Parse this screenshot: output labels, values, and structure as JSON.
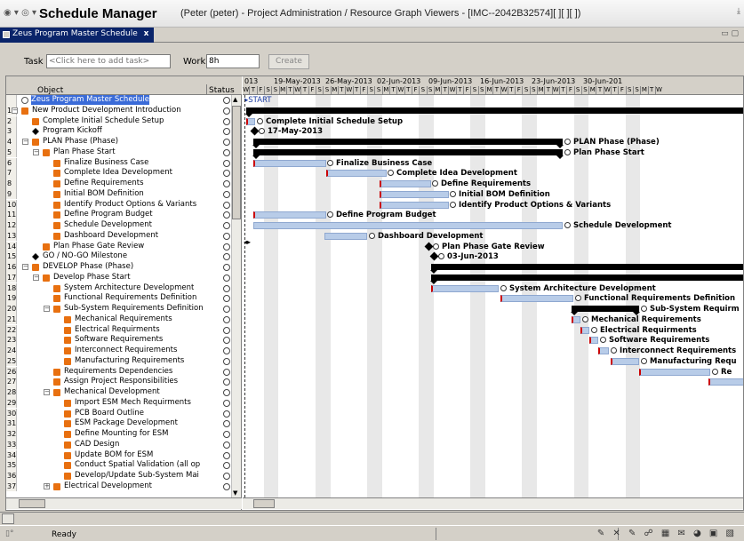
{
  "window": {
    "nav_icons": "◉ ▾ ◎ ▾",
    "app_title": "Schedule Manager",
    "context": "(Peter (peter) - Project Administration / Resource Graph Viewers - [IMC--2042B32574][ ][ ][ ])",
    "right_glyph": "⤓"
  },
  "tab": {
    "label": "Zeus Program Master Schedule",
    "close": "x",
    "right": "▭ ▢"
  },
  "task_bar": {
    "task_label": "Task",
    "task_placeholder": "<Click here to add task>",
    "work_label": "Work",
    "work_value": "8h",
    "create_label": "Create"
  },
  "outline": {
    "col_object": "Object",
    "col_status": "Status",
    "root_label": "Zeus Program Master Schedule",
    "rows": [
      {
        "n": "1",
        "label": "New Product Development Introduction",
        "lvl": 0,
        "kind": "sum",
        "twisty": "−"
      },
      {
        "n": "2",
        "label": "Complete Initial Schedule Setup",
        "lvl": 1,
        "kind": "task",
        "twisty": ""
      },
      {
        "n": "3",
        "label": "Program Kickoff",
        "lvl": 1,
        "kind": "mile",
        "twisty": ""
      },
      {
        "n": "4",
        "label": "PLAN Phase (Phase)",
        "lvl": 1,
        "kind": "sum",
        "twisty": "−"
      },
      {
        "n": "5",
        "label": "Plan Phase Start",
        "lvl": 2,
        "kind": "sum",
        "twisty": "−"
      },
      {
        "n": "6",
        "label": "Finalize Business Case",
        "lvl": 3,
        "kind": "task",
        "twisty": ""
      },
      {
        "n": "7",
        "label": "Complete Idea Development",
        "lvl": 3,
        "kind": "task",
        "twisty": ""
      },
      {
        "n": "8",
        "label": "Define Requirements",
        "lvl": 3,
        "kind": "task",
        "twisty": ""
      },
      {
        "n": "9",
        "label": "Initial BOM Definition",
        "lvl": 3,
        "kind": "task",
        "twisty": ""
      },
      {
        "n": "10",
        "label": "Identify Product Options & Variants",
        "lvl": 3,
        "kind": "task",
        "twisty": ""
      },
      {
        "n": "11",
        "label": "Define Program Budget",
        "lvl": 3,
        "kind": "task",
        "twisty": ""
      },
      {
        "n": "12",
        "label": "Schedule Development",
        "lvl": 3,
        "kind": "task",
        "twisty": ""
      },
      {
        "n": "13",
        "label": "Dashboard Development",
        "lvl": 3,
        "kind": "task",
        "twisty": ""
      },
      {
        "n": "14",
        "label": "Plan Phase Gate Review",
        "lvl": 2,
        "kind": "task",
        "twisty": ""
      },
      {
        "n": "15",
        "label": "GO / NO-GO Milestone",
        "lvl": 1,
        "kind": "mile",
        "twisty": ""
      },
      {
        "n": "16",
        "label": "DEVELOP Phase (Phase)",
        "lvl": 1,
        "kind": "sum",
        "twisty": "−"
      },
      {
        "n": "17",
        "label": "Develop Phase Start",
        "lvl": 2,
        "kind": "sum",
        "twisty": "−"
      },
      {
        "n": "18",
        "label": "System Architecture Development",
        "lvl": 3,
        "kind": "task",
        "twisty": ""
      },
      {
        "n": "19",
        "label": "Functional Requirements Definition",
        "lvl": 3,
        "kind": "task",
        "twisty": ""
      },
      {
        "n": "20",
        "label": "Sub-System Requirements Definition",
        "lvl": 3,
        "kind": "sum",
        "twisty": "−"
      },
      {
        "n": "21",
        "label": "Mechanical Requirements",
        "lvl": 4,
        "kind": "task",
        "twisty": ""
      },
      {
        "n": "22",
        "label": "Electrical Requirments",
        "lvl": 4,
        "kind": "task",
        "twisty": ""
      },
      {
        "n": "23",
        "label": "Software Requirements",
        "lvl": 4,
        "kind": "task",
        "twisty": ""
      },
      {
        "n": "24",
        "label": "Interconnect Requirements",
        "lvl": 4,
        "kind": "task",
        "twisty": ""
      },
      {
        "n": "25",
        "label": "Manufacturing Requirements",
        "lvl": 4,
        "kind": "task",
        "twisty": ""
      },
      {
        "n": "26",
        "label": "Requirements Dependencies",
        "lvl": 3,
        "kind": "task",
        "twisty": ""
      },
      {
        "n": "27",
        "label": "Assign Project Responsibilities",
        "lvl": 3,
        "kind": "task",
        "twisty": ""
      },
      {
        "n": "28",
        "label": "Mechanical Development",
        "lvl": 3,
        "kind": "sum",
        "twisty": "−"
      },
      {
        "n": "29",
        "label": "Import ESM Mech Requirments",
        "lvl": 4,
        "kind": "task",
        "twisty": ""
      },
      {
        "n": "30",
        "label": "PCB Board Outline",
        "lvl": 4,
        "kind": "task",
        "twisty": ""
      },
      {
        "n": "31",
        "label": "ESM Package Development",
        "lvl": 4,
        "kind": "task",
        "twisty": ""
      },
      {
        "n": "32",
        "label": "Define Mounting for ESM",
        "lvl": 4,
        "kind": "task",
        "twisty": ""
      },
      {
        "n": "33",
        "label": "CAD Design",
        "lvl": 4,
        "kind": "task",
        "twisty": ""
      },
      {
        "n": "34",
        "label": "Update BOM for ESM",
        "lvl": 4,
        "kind": "task",
        "twisty": ""
      },
      {
        "n": "35",
        "label": "Conduct Spatial Validation (all op",
        "lvl": 4,
        "kind": "task",
        "twisty": ""
      },
      {
        "n": "36",
        "label": "Develop/Update Sub-System Mai",
        "lvl": 4,
        "kind": "task",
        "twisty": ""
      },
      {
        "n": "37",
        "label": "Electrical Development",
        "lvl": 3,
        "kind": "sum",
        "twisty": "+"
      }
    ]
  },
  "gantt": {
    "weeks": [
      "013",
      "19-May-2013",
      "26-May-2013",
      "02-Jun-2013",
      "09-Jun-2013",
      "16-Jun-2013",
      "23-Jun-2013",
      "30-Jun-201"
    ],
    "day_letters": [
      "W",
      "T",
      "F",
      "S",
      "S",
      "M",
      "T",
      "W",
      "T",
      "F",
      "S",
      "S",
      "M",
      "T",
      "W",
      "T",
      "F",
      "S",
      "S",
      "M",
      "T",
      "W",
      "T",
      "F",
      "S",
      "S",
      "M",
      "T",
      "W",
      "T",
      "F",
      "S",
      "S",
      "M",
      "T",
      "W",
      "T",
      "F",
      "S",
      "S",
      "M",
      "T",
      "W",
      "T",
      "F",
      "S",
      "S",
      "M",
      "T",
      "W",
      "T",
      "F",
      "S",
      "S",
      "M",
      "T",
      "W"
    ],
    "start_label": "START",
    "labels": {
      "r2": "Complete Initial Schedule Setup",
      "r3": "17-May-2013",
      "r4": "PLAN Phase (Phase)",
      "r5": "Plan Phase Start",
      "r6": "Finalize Business Case",
      "r7": "Complete Idea Development",
      "r8": "Define Requirements",
      "r9": "Initial BOM Definition",
      "r10": "Identify Product Options & Variants",
      "r11": "Define Program Budget",
      "r12": "Schedule Development",
      "r13": "Dashboard Development",
      "r14": "Plan Phase Gate Review",
      "r15": "03-Jun-2013",
      "r18": "System Architecture Development",
      "r19": "Functional Requirements Definition",
      "r20": "Sub-System Requirm",
      "r21": "Mechanical Requirements",
      "r22": "Electrical Requirments",
      "r23": "Software Requirements",
      "r24": "Interconnect Requirements",
      "r25": "Manufacturing Requ",
      "r26": "Re"
    }
  },
  "status": {
    "text": "Ready",
    "icons": "✎ ✕ ✎ ☍ ▦ ✉ ◕ ▣ ▧"
  }
}
